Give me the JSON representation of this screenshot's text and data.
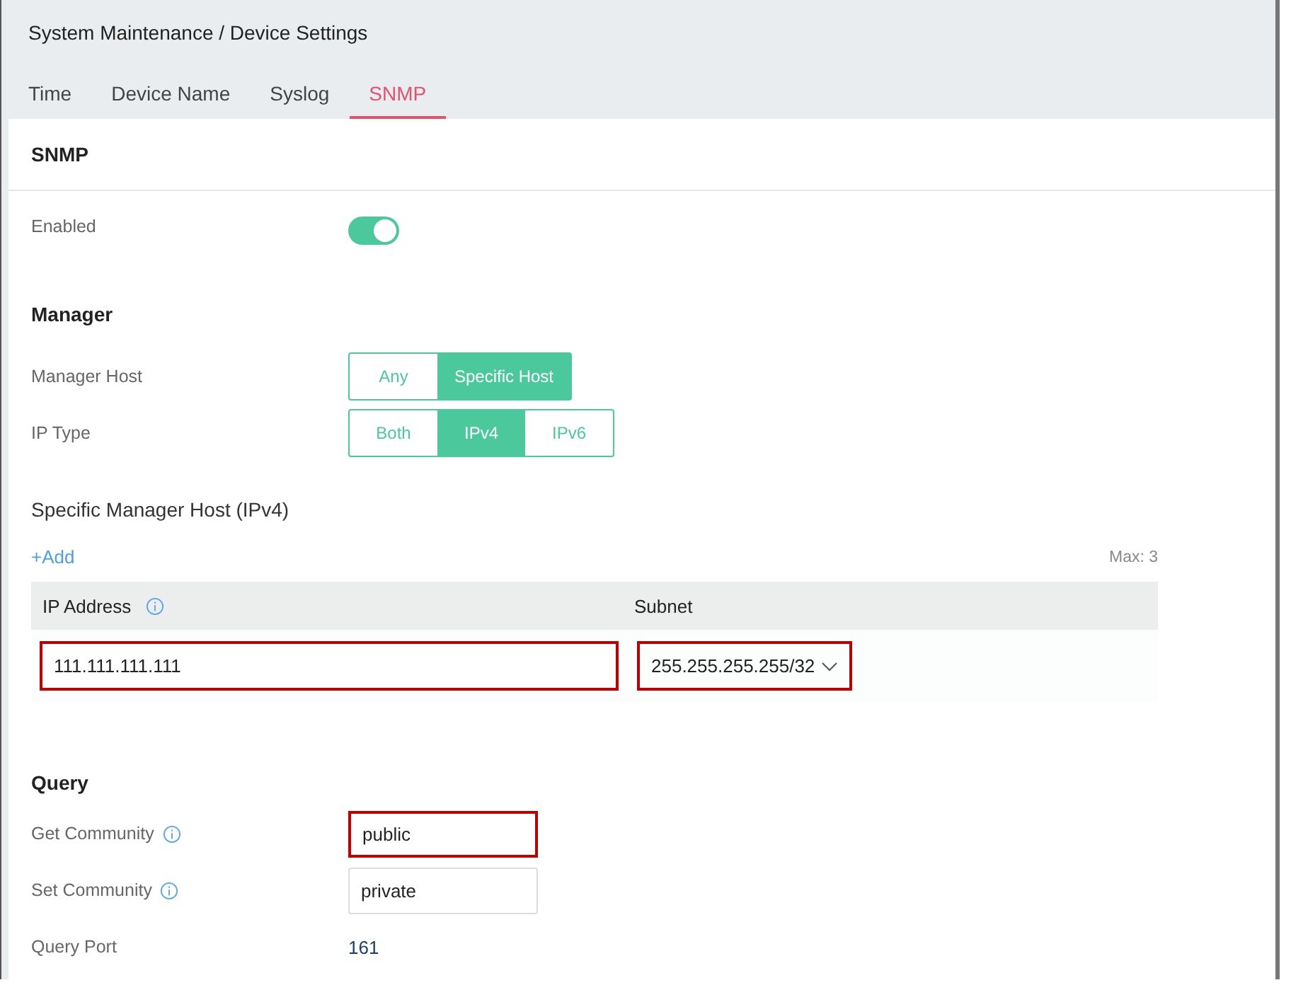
{
  "breadcrumb": "System Maintenance / Device Settings",
  "tabs": [
    {
      "label": "Time",
      "selected": false
    },
    {
      "label": "Device Name",
      "selected": false
    },
    {
      "label": "Syslog",
      "selected": false
    },
    {
      "label": "SNMP",
      "selected": true
    }
  ],
  "card_title": "SNMP",
  "enabled": {
    "label": "Enabled",
    "on": true
  },
  "manager": {
    "heading": "Manager",
    "segments": [
      {
        "label": "Manager Host",
        "options": [
          {
            "label": "Any",
            "selected": false
          },
          {
            "label": "Specific Host",
            "selected": true
          }
        ]
      },
      {
        "label": "IP Type",
        "options": [
          {
            "label": "Both",
            "selected": false
          },
          {
            "label": "IPv4",
            "selected": true
          },
          {
            "label": "IPv6",
            "selected": false
          }
        ]
      }
    ],
    "host_heading": "Specific Manager Host (IPv4)",
    "add": "+Add",
    "max": "Max: 3",
    "table": {
      "columns": [
        {
          "label": "IP Address",
          "info": true
        },
        {
          "label": "Subnet"
        }
      ],
      "rows": [
        {
          "ip": {
            "value": "111.111.111.111",
            "highlighted": true
          },
          "subnet": {
            "value": "255.255.255.255/32",
            "highlighted": true
          }
        }
      ]
    }
  },
  "query": {
    "heading": "Query",
    "fields": [
      {
        "kind": "input",
        "label": "Get Community",
        "info": true,
        "value": "public",
        "highlighted": true
      },
      {
        "kind": "input",
        "label": "Set Community",
        "info": true,
        "value": "private",
        "highlighted": false
      },
      {
        "kind": "text",
        "label": "Query Port",
        "value": "161"
      }
    ]
  }
}
